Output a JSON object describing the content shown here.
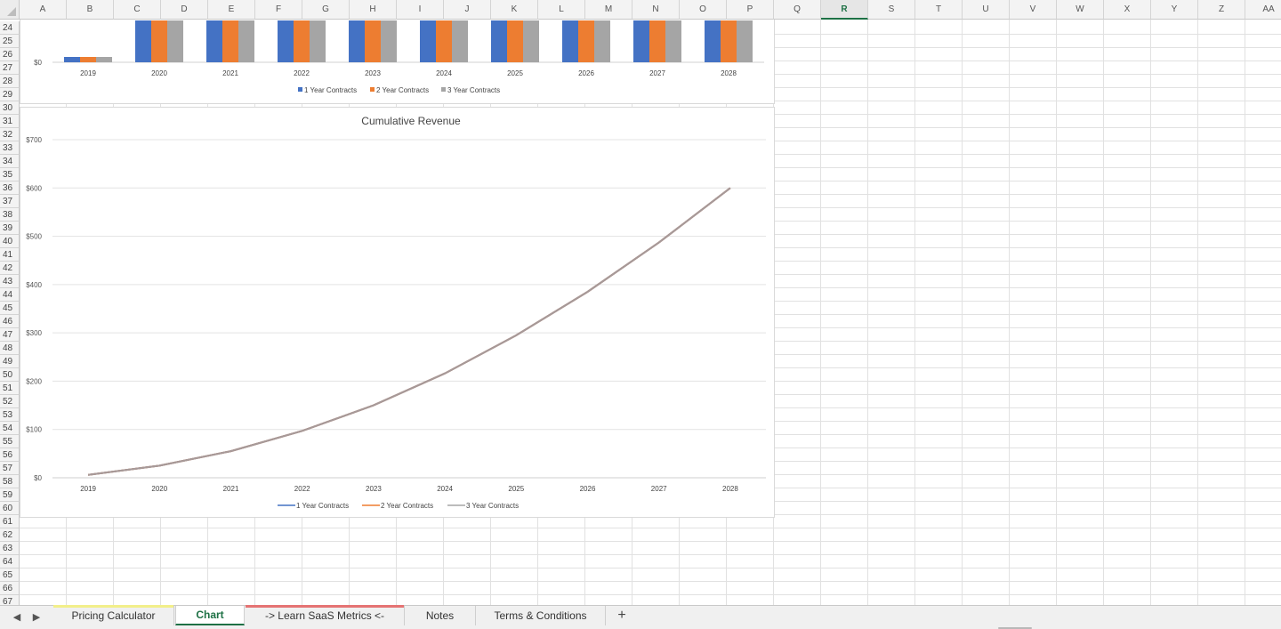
{
  "columns": [
    "A",
    "B",
    "C",
    "D",
    "E",
    "F",
    "G",
    "H",
    "I",
    "J",
    "K",
    "L",
    "M",
    "N",
    "O",
    "P",
    "Q",
    "R",
    "S",
    "T",
    "U",
    "V",
    "W",
    "X",
    "Y",
    "Z",
    "AA"
  ],
  "selected_column": "R",
  "rows": [
    "24",
    "25",
    "26",
    "27",
    "28",
    "29",
    "30",
    "31",
    "32",
    "33",
    "34",
    "35",
    "36",
    "37",
    "38",
    "39",
    "40",
    "41",
    "42",
    "43",
    "44",
    "45",
    "46",
    "47",
    "48",
    "49",
    "50",
    "51",
    "52",
    "53",
    "54",
    "55",
    "56",
    "57",
    "58",
    "59",
    "60",
    "61",
    "62",
    "63",
    "64",
    "65",
    "66",
    "67"
  ],
  "colors": {
    "series_1": "#4472c4",
    "series_2": "#ed7d31",
    "series_3": "#a5a5a5",
    "line_overlap": "#a69a9a",
    "accent": "#1e7145"
  },
  "chart_data": [
    {
      "type": "bar",
      "title": "",
      "categories": [
        "2019",
        "2020",
        "2021",
        "2022",
        "2023",
        "2024",
        "2025",
        "2026",
        "2027",
        "2028"
      ],
      "y_tick_labels": [
        "$0"
      ],
      "ylim_note": "visible region cropped at top",
      "legend_position": "bottom",
      "series": [
        {
          "name": "1 Year Contracts",
          "values": [
            6,
            47,
            47,
            47,
            47,
            47,
            47,
            47,
            47,
            47
          ]
        },
        {
          "name": "2 Year Contracts",
          "values": [
            6,
            47,
            47,
            47,
            47,
            47,
            47,
            47,
            47,
            47
          ]
        },
        {
          "name": "3 Year Contracts",
          "values": [
            6,
            47,
            47,
            47,
            47,
            47,
            47,
            47,
            47,
            47
          ]
        }
      ]
    },
    {
      "type": "line",
      "title": "Cumulative Revenue",
      "categories": [
        "2019",
        "2020",
        "2021",
        "2022",
        "2023",
        "2024",
        "2025",
        "2026",
        "2027",
        "2028"
      ],
      "ylim": [
        0,
        700
      ],
      "y_ticks": [
        0,
        100,
        200,
        300,
        400,
        500,
        600,
        700
      ],
      "y_tick_labels": [
        "$0",
        "$100",
        "$200",
        "$300",
        "$400",
        "$500",
        "$600",
        "$700"
      ],
      "grid": true,
      "legend_position": "bottom",
      "series": [
        {
          "name": "1 Year Contracts",
          "values": [
            6,
            25,
            55,
            97,
            150,
            216,
            295,
            385,
            487,
            600
          ]
        },
        {
          "name": "2 Year Contracts",
          "values": [
            6,
            25,
            55,
            97,
            150,
            216,
            295,
            385,
            487,
            600
          ]
        },
        {
          "name": "3 Year Contracts",
          "values": [
            6,
            25,
            55,
            97,
            150,
            216,
            295,
            385,
            487,
            600
          ]
        }
      ]
    }
  ],
  "tabs": [
    {
      "label": "Pricing Calculator",
      "color": "#f2ef8a",
      "active": false
    },
    {
      "label": "Chart",
      "color": "",
      "active": true
    },
    {
      "label": "-> Learn SaaS Metrics <-",
      "color": "#e57373",
      "active": false
    },
    {
      "label": "Notes",
      "color": "",
      "active": false
    },
    {
      "label": "Terms & Conditions",
      "color": "",
      "active": false
    }
  ],
  "add_sheet_label": "+"
}
